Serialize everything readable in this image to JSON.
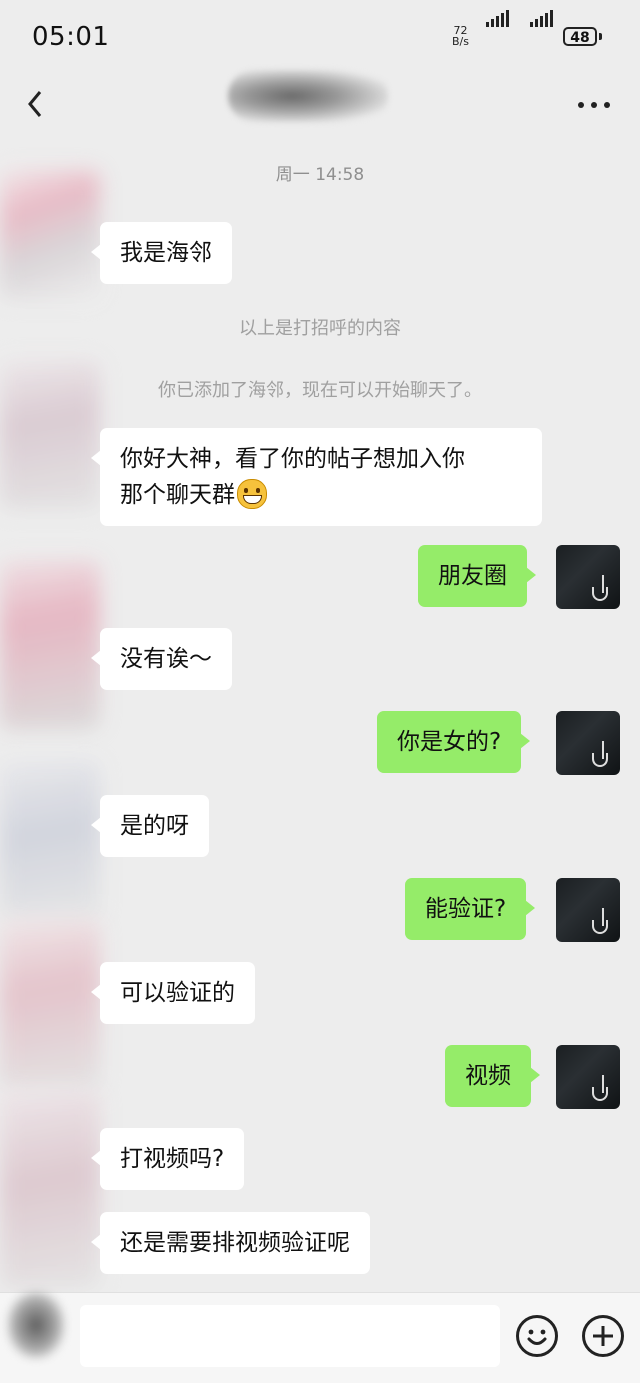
{
  "status_bar": {
    "time": "05:01",
    "net_speed_value": "72",
    "net_speed_unit": "B/s",
    "battery": "48"
  },
  "nav": {
    "back_icon": "chevron-left-icon",
    "more_icon": "more-dots-icon"
  },
  "chat": {
    "timestamp": "周一 14:58",
    "system_messages": [
      "以上是打招呼的内容",
      "你已添加了海邻，现在可以开始聊天了。"
    ],
    "messages": [
      {
        "side": "in",
        "text": "我是海邻"
      },
      {
        "side": "in",
        "text_line1": "你好大神，看了你的帖子想加入你",
        "text_line2": "那个聊天群",
        "emoji": "grinning-face-emoji"
      },
      {
        "side": "out",
        "text": "朋友圈"
      },
      {
        "side": "in",
        "text": "没有诶～"
      },
      {
        "side": "out",
        "text": "你是女的?"
      },
      {
        "side": "in",
        "text": "是的呀"
      },
      {
        "side": "out",
        "text": "能验证?"
      },
      {
        "side": "in",
        "text": "可以验证的"
      },
      {
        "side": "out",
        "text": "视频"
      },
      {
        "side": "in",
        "text": "打视频吗?"
      },
      {
        "side": "in",
        "text": "还是需要排视频验证呢"
      }
    ]
  },
  "input_bar": {
    "input_value": "",
    "emoji_icon": "smiley-icon",
    "plus_icon": "plus-icon"
  },
  "colors": {
    "background": "#ededed",
    "incoming_bubble": "#ffffff",
    "outgoing_bubble": "#95ec69"
  }
}
